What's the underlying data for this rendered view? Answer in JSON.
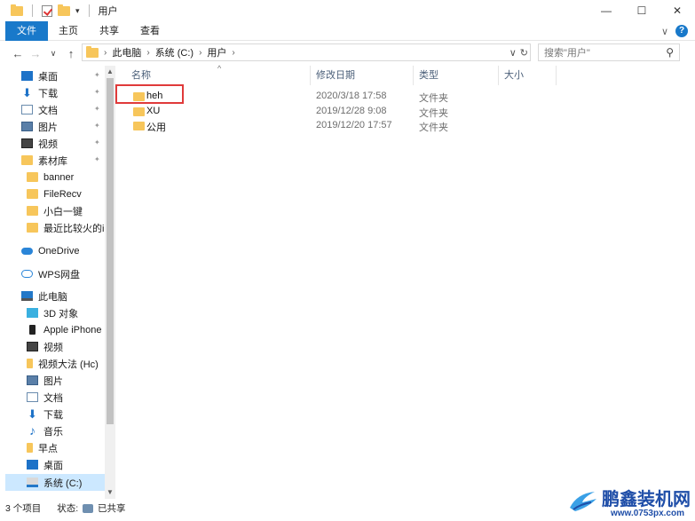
{
  "window": {
    "title": "用户",
    "controls": {
      "minimize": "—",
      "maximize": "☐",
      "close": "✕"
    }
  },
  "ribbon": {
    "tabs": [
      "文件",
      "主页",
      "共享",
      "查看"
    ],
    "expand_glyph": "∨",
    "help_glyph": "?"
  },
  "address": {
    "crumbs": [
      "此电脑",
      "系统 (C:)",
      "用户"
    ],
    "dropdown_glyph": "∨",
    "refresh_glyph": "↻"
  },
  "search": {
    "placeholder": "搜索\"用户\""
  },
  "nav": {
    "items": [
      {
        "label": "桌面",
        "icon": "desktop-icon",
        "pinned": true
      },
      {
        "label": "下载",
        "icon": "download-icon",
        "pinned": true
      },
      {
        "label": "文档",
        "icon": "document-icon",
        "pinned": true
      },
      {
        "label": "图片",
        "icon": "pictures-icon",
        "pinned": true
      },
      {
        "label": "视频",
        "icon": "video-icon",
        "pinned": true
      },
      {
        "label": "素材库",
        "icon": "folder-icon",
        "pinned": true
      },
      {
        "label": "banner",
        "icon": "folder-icon",
        "pinned": false
      },
      {
        "label": "FileRecv",
        "icon": "folder-icon",
        "pinned": false
      },
      {
        "label": "小白一键",
        "icon": "folder-icon",
        "pinned": false
      },
      {
        "label": "最近比较火的ipl",
        "icon": "folder-icon",
        "pinned": false
      },
      {
        "label": "OneDrive",
        "icon": "cloud-icon",
        "pinned": false
      },
      {
        "label": "WPS网盘",
        "icon": "wps-cloud-icon",
        "pinned": false
      },
      {
        "label": "此电脑",
        "icon": "computer-icon",
        "pinned": false
      },
      {
        "label": "3D 对象",
        "icon": "3d-objects-icon",
        "pinned": false
      },
      {
        "label": "Apple iPhone",
        "icon": "phone-icon",
        "pinned": false
      },
      {
        "label": "视频",
        "icon": "video-icon",
        "pinned": false
      },
      {
        "label": "视频大法 (Hc)",
        "icon": "drive-icon",
        "pinned": false
      },
      {
        "label": "图片",
        "icon": "pictures-icon",
        "pinned": false
      },
      {
        "label": "文档",
        "icon": "document-icon",
        "pinned": false
      },
      {
        "label": "下载",
        "icon": "download-icon",
        "pinned": false
      },
      {
        "label": "音乐",
        "icon": "music-icon",
        "pinned": false
      },
      {
        "label": "早点",
        "icon": "drive-icon",
        "pinned": false
      },
      {
        "label": "桌面",
        "icon": "desktop-icon",
        "pinned": false
      },
      {
        "label": "系统 (C:)",
        "icon": "system-drive-icon",
        "pinned": false,
        "selected": true
      }
    ],
    "pin_glyph": "📌"
  },
  "columns": {
    "name": "名称",
    "modified": "修改日期",
    "type": "类型",
    "size": "大小"
  },
  "files": [
    {
      "name": "heh",
      "modified": "2020/3/18 17:58",
      "type": "文件夹",
      "highlighted": true
    },
    {
      "name": "XU",
      "modified": "2019/12/28 9:08",
      "type": "文件夹"
    },
    {
      "name": "公用",
      "modified": "2019/12/20 17:57",
      "type": "文件夹"
    }
  ],
  "status": {
    "count": "3 个项目",
    "state_label": "状态:",
    "state_value": "已共享"
  },
  "watermark": {
    "brand": "鹏鑫装机网",
    "url": "www.0753px.com"
  }
}
